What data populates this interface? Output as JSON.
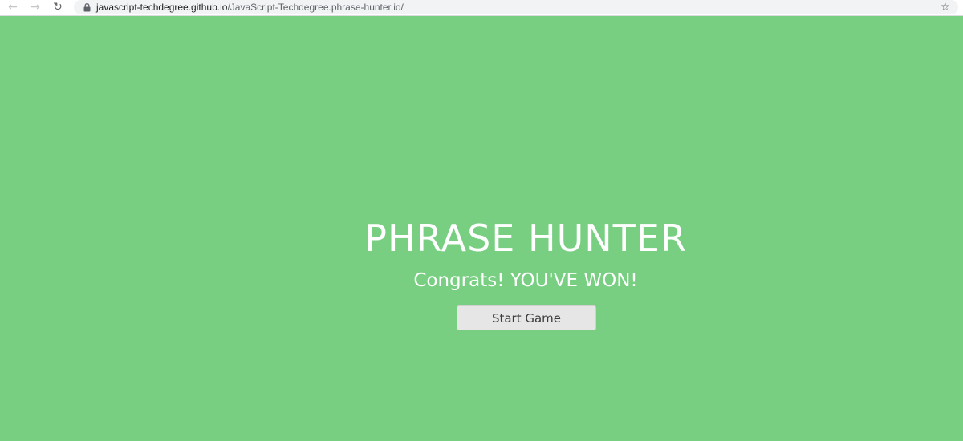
{
  "browser": {
    "url_host": "javascript-techdegree.github.io",
    "url_path": "/JavaScript-Techdegree.phrase-hunter.io/",
    "back_icon": "←",
    "forward_icon": "→",
    "reload_icon": "↻",
    "star_icon": "☆"
  },
  "game": {
    "title": "PHRASE HUNTER",
    "message": "Congrats! YOU'VE WON!",
    "start_button_label": "Start Game",
    "background_color": "#78cf82"
  }
}
